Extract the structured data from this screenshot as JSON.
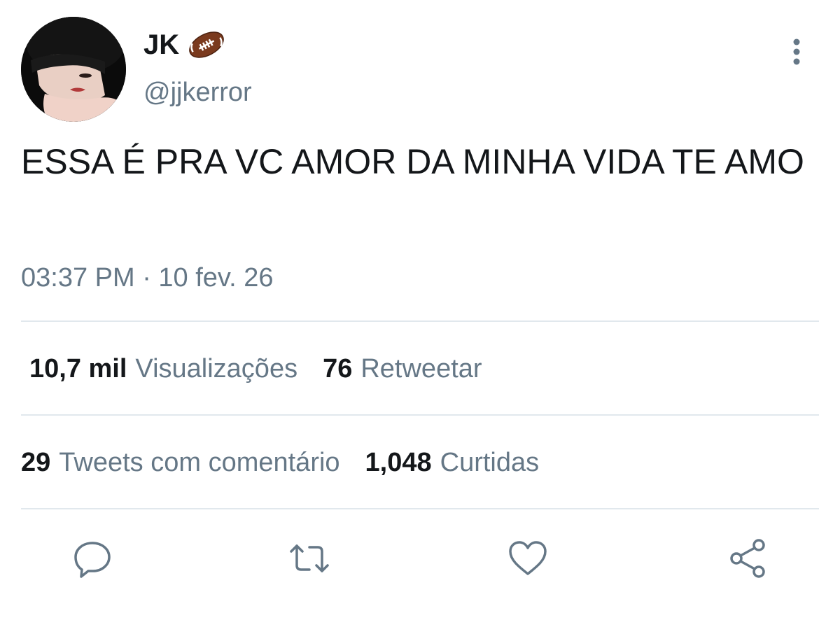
{
  "user": {
    "display_name": "JK",
    "name_emoji": "football-icon",
    "handle": "@jjkerror",
    "avatar": "avatar"
  },
  "tweet": {
    "text": "ESSA É PRA VC AMOR DA MINHA VIDA TE AMO",
    "timestamp": "03:37 PM · 10 fev. 26"
  },
  "stats": {
    "views_count": "10,7 mil",
    "views_label": "Visualizações",
    "retweets_count": "76",
    "retweets_label": "Retweetar",
    "quotes_count": "29",
    "quotes_label": "Tweets com comentário",
    "likes_count": "1,048",
    "likes_label": "Curtidas"
  },
  "actions": [
    "reply-icon",
    "retweet-icon",
    "like-icon",
    "share-icon"
  ],
  "colors": {
    "text_primary": "#14171a",
    "text_secondary": "#657786",
    "divider": "#e1e8ed",
    "icon": "#657786"
  }
}
